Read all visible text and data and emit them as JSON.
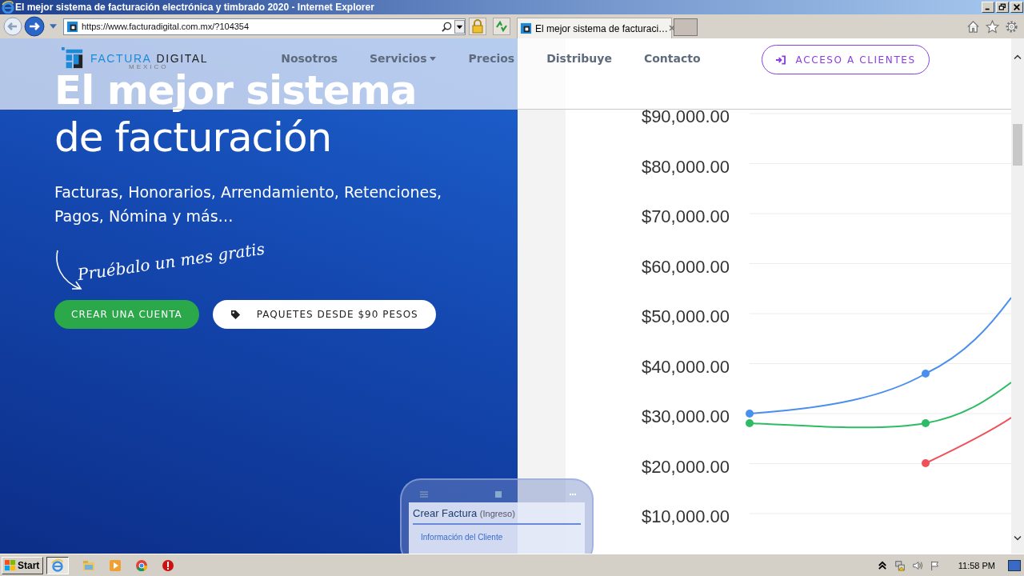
{
  "window": {
    "title": "El mejor sistema de facturación electrónica y timbrado 2020 - Internet Explorer"
  },
  "browser": {
    "address": "https://www.facturadigital.com.mx/?104354",
    "tabs": [
      {
        "title": "El mejor sistema de facturaci…",
        "selected": true
      }
    ]
  },
  "site_header": {
    "logo": {
      "word_1": "FACTURA",
      "word_2": "DIGITAL",
      "tagline": "MEXICO"
    },
    "nav": [
      {
        "label": "Nosotros",
        "dropdown": false
      },
      {
        "label": "Servicios",
        "dropdown": true
      },
      {
        "label": "Precios",
        "dropdown": false
      },
      {
        "label": "Distribuye",
        "dropdown": false
      },
      {
        "label": "Contacto",
        "dropdown": false
      }
    ],
    "login_button": "ACCESO A CLIENTES"
  },
  "hero": {
    "title_line_1": "El mejor sistema",
    "title_line_2": "de facturación",
    "subtitle": "Facturas, Honorarios, Arrendamiento, Retenciones, Pagos, Nómina y más…",
    "trial_note": "Pruébalo un mes gratis",
    "buttons": [
      {
        "label": "CREAR UNA CUENTA",
        "kind": "primary"
      },
      {
        "label": "PAQUETES DESDE $90 PESOS",
        "kind": "secondary"
      }
    ]
  },
  "phone_preview": {
    "title": "Crear Factura",
    "title_note": "(Ingreso)",
    "section": "Información del Cliente"
  },
  "chart": {
    "axis_labels": [
      "$90,000.00",
      "$80,000.00",
      "$70,000.00",
      "$60,000.00",
      "$50,000.00",
      "$40,000.00",
      "$30,000.00",
      "$20,000.00",
      "$10,000.00"
    ],
    "lines": [
      {
        "color": "#4a8ff0"
      },
      {
        "color": "#2dbb63"
      },
      {
        "color": "#f0505a"
      }
    ]
  },
  "taskbar": {
    "start": "Start",
    "clock": "11:58 PM"
  }
}
